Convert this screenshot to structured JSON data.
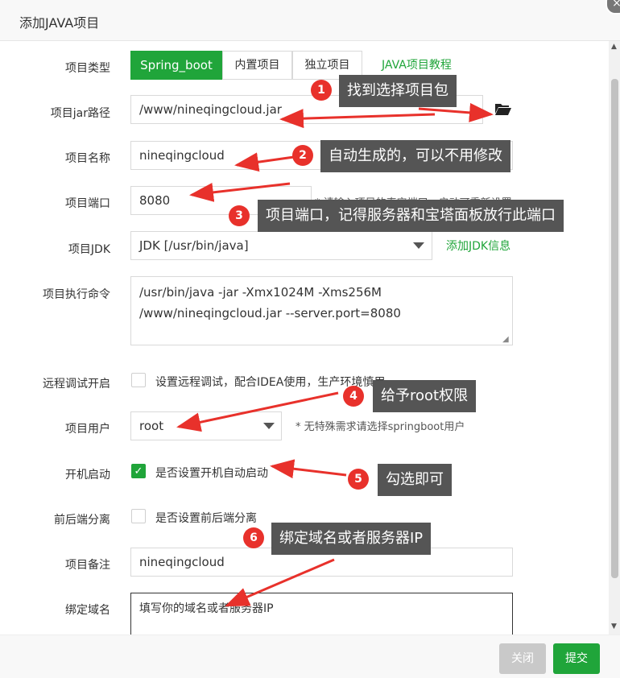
{
  "dialog": {
    "title": "添加JAVA项目",
    "close_icon": "close-icon"
  },
  "form": {
    "project_type": {
      "label": "项目类型",
      "options": [
        "Spring_boot",
        "内置项目",
        "独立项目"
      ],
      "selected": "Spring_boot",
      "tutorial_link": "JAVA项目教程"
    },
    "jar_path": {
      "label": "项目jar路径",
      "value": "/www/nineqingcloud.jar",
      "icon": "folder-open-icon"
    },
    "project_name": {
      "label": "项目名称",
      "value": "nineqingcloud"
    },
    "project_port": {
      "label": "项目端口",
      "value": "8080",
      "hint": "* 请输入项目的真实端口，启动可重新设置"
    },
    "project_jdk": {
      "label": "项目JDK",
      "value": "JDK [/usr/bin/java]",
      "add_link": "添加JDK信息"
    },
    "exec_command": {
      "label": "项目执行命令",
      "value": "/usr/bin/java -jar -Xmx1024M -Xms256M\n/www/nineqingcloud.jar --server.port=8080"
    },
    "remote_debug": {
      "label": "远程调试开启",
      "text": "设置远程调试，配合IDEA使用，生产环境慎用",
      "checked": false
    },
    "project_user": {
      "label": "项目用户",
      "value": "root",
      "hint": "* 无特殊需求请选择springboot用户"
    },
    "autostart": {
      "label": "开机启动",
      "text": "是否设置开机自动启动",
      "checked": true
    },
    "separation": {
      "label": "前后端分离",
      "text": "是否设置前后端分离",
      "checked": false
    },
    "remark": {
      "label": "项目备注",
      "value": "nineqingcloud"
    },
    "domain": {
      "label": "绑定域名",
      "placeholder": "填写你的域名或者服务器IP"
    }
  },
  "footer": {
    "close_label": "关闭",
    "submit_label": "提交"
  },
  "annotations": [
    {
      "num": "1",
      "text": "找到选择项目包"
    },
    {
      "num": "2",
      "text": "自动生成的，可以不用修改"
    },
    {
      "num": "3",
      "text": "项目端口，记得服务器和宝塔面板放行此端口"
    },
    {
      "num": "4",
      "text": "给予root权限"
    },
    {
      "num": "5",
      "text": "勾选即可"
    },
    {
      "num": "6",
      "text": "绑定域名或者服务器IP"
    }
  ],
  "colors": {
    "accent": "#20a53a",
    "badge": "#e8312b",
    "tooltip": "#555555"
  }
}
